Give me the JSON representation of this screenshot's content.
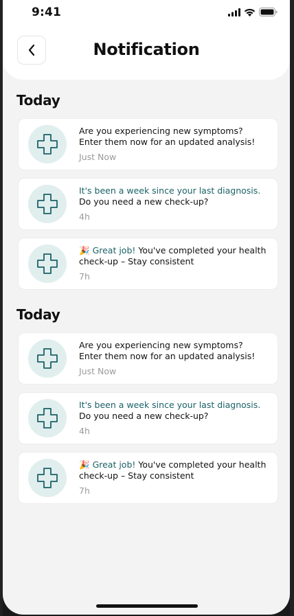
{
  "status_bar": {
    "time": "9:41"
  },
  "header": {
    "title": "Notification"
  },
  "sections": [
    {
      "title": "Today",
      "items": [
        {
          "line1": "Are you experiencing new symptoms?",
          "line2": "Enter them now for an updated analysis!",
          "time": "Just Now"
        },
        {
          "highlight": "It's been a week since your last diagnosis.",
          "line2": "Do you need a new check-up?",
          "time": "4h"
        },
        {
          "emoji": "🎉",
          "highlight": "Great job!",
          "line1": " You've completed your health",
          "line2": "check-up – Stay consistent",
          "time": "7h"
        }
      ]
    },
    {
      "title": "Today",
      "items": [
        {
          "line1": "Are you experiencing new symptoms?",
          "line2": "Enter them now for an updated analysis!",
          "time": "Just Now"
        },
        {
          "highlight": "It's been a week since your last diagnosis.",
          "line2": "Do you need a new check-up?",
          "time": "4h"
        },
        {
          "emoji": "🎉",
          "highlight": "Great job!",
          "line1": " You've completed your health",
          "line2": "check-up – Stay consistent",
          "time": "7h"
        }
      ]
    }
  ],
  "colors": {
    "accent": "#1a6166",
    "icon_bg": "#e1eeee",
    "background": "#f3f3f3"
  },
  "icons": {
    "back": "chevron-left-icon",
    "item": "medical-cross-icon"
  }
}
